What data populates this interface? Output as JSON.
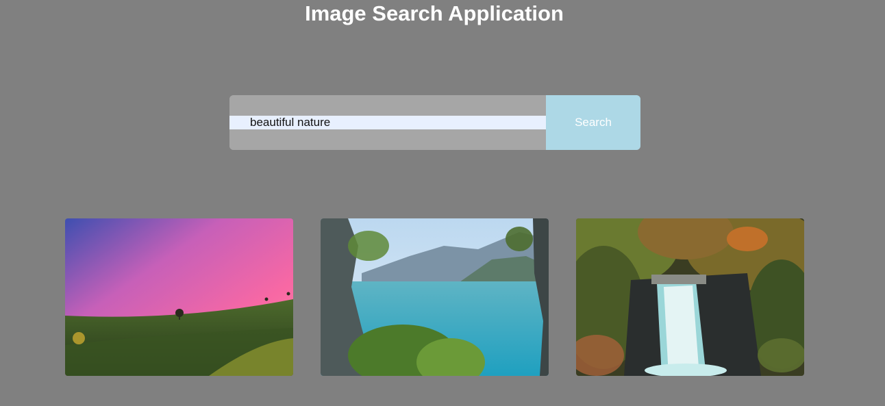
{
  "app": {
    "title": "Image Search Application"
  },
  "search": {
    "value": "beautiful nature",
    "button_label": "Search"
  },
  "results": [
    {
      "icon": "pink-sky-hill-image"
    },
    {
      "icon": "mountain-lake-image"
    },
    {
      "icon": "waterfall-forest-image"
    }
  ],
  "colors": {
    "background": "#808080",
    "search_button": "#add8e6",
    "input_bg": "#e8f0fe"
  }
}
